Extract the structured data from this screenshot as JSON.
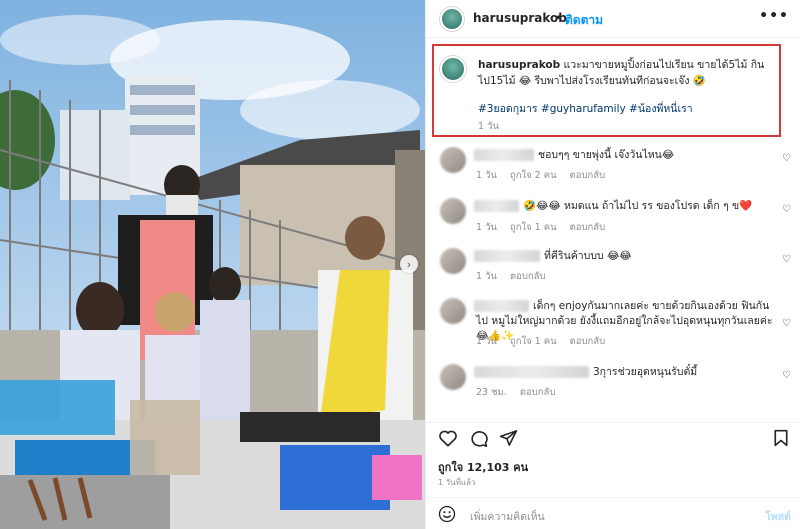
{
  "post": {
    "username": "harusuprakob",
    "separator": "•",
    "follow_label": "ติดตาม",
    "more_label": "•••",
    "caption": {
      "username": "harusuprakob",
      "text": "แวะมาขายหมูปิ้งก่อนไปเรียน ขายได้5ไม้ กินไป15ไม้ 😂 รีบพาไปส่งโรงเรียนทันทีก่อนจะเจ๊ง 🤣",
      "tags": "#3ยอดกุมาร #guyharufamily #น้องพี่หนี่เรา",
      "time": "1 วัน"
    }
  },
  "comments": [
    {
      "text": "ชอบๆๆ ขายพุ่งนี้ เจ๊งวันไหน😂",
      "time": "1 วัน",
      "likes": "ถูกใจ 2 คน",
      "reply": "ตอบกลับ"
    },
    {
      "text": "🤣😂😂 หมดแน ถ้าไม่ไป รร ของโปรด เด็ก ๆ ข❤️",
      "time": "1 วัน",
      "likes": "ถูกใจ 1 คน",
      "reply": "ตอบกลับ"
    },
    {
      "text": "ที่คีรินค้าบบบ 😂😂",
      "time": "1 วัน",
      "likes": "",
      "reply": "ตอบกลับ"
    },
    {
      "text": "เด็กๆ enjoyกันมากเลยค่ะ ขายด้วยกินเองด้วย ฟินกันไป หมูไม่ใหญ่มากด้วย ยังงี้แถมอีกอยู่ใกล้จะไปอุดหนุนทุกวันเลยค่ะ😂👍✨",
      "time": "1 วัน",
      "likes": "ถูกใจ 1 คน",
      "reply": "ตอบกลับ"
    },
    {
      "text": "3กุารช่วยอุดหนุนรับตั๋มี้",
      "time": "23 ชม.",
      "likes": "",
      "reply": "ตอบกลับ"
    }
  ],
  "footer": {
    "likes": "ถูกใจ 12,103 คน",
    "date": "1 วันที่แล้ว",
    "add_comment_placeholder": "เพิ่มความคิดเห็น",
    "post_label": "โพสต์"
  },
  "icons": {
    "heart": "heart-icon",
    "comment": "comment-icon",
    "share": "share-icon",
    "bookmark": "bookmark-icon",
    "emoji": "emoji-icon",
    "next": "chevron-right-icon"
  },
  "colors": {
    "link": "#0095f6",
    "hashtag": "#00376b",
    "highlight": "#d23a3a",
    "apron": "#f0d83a"
  }
}
